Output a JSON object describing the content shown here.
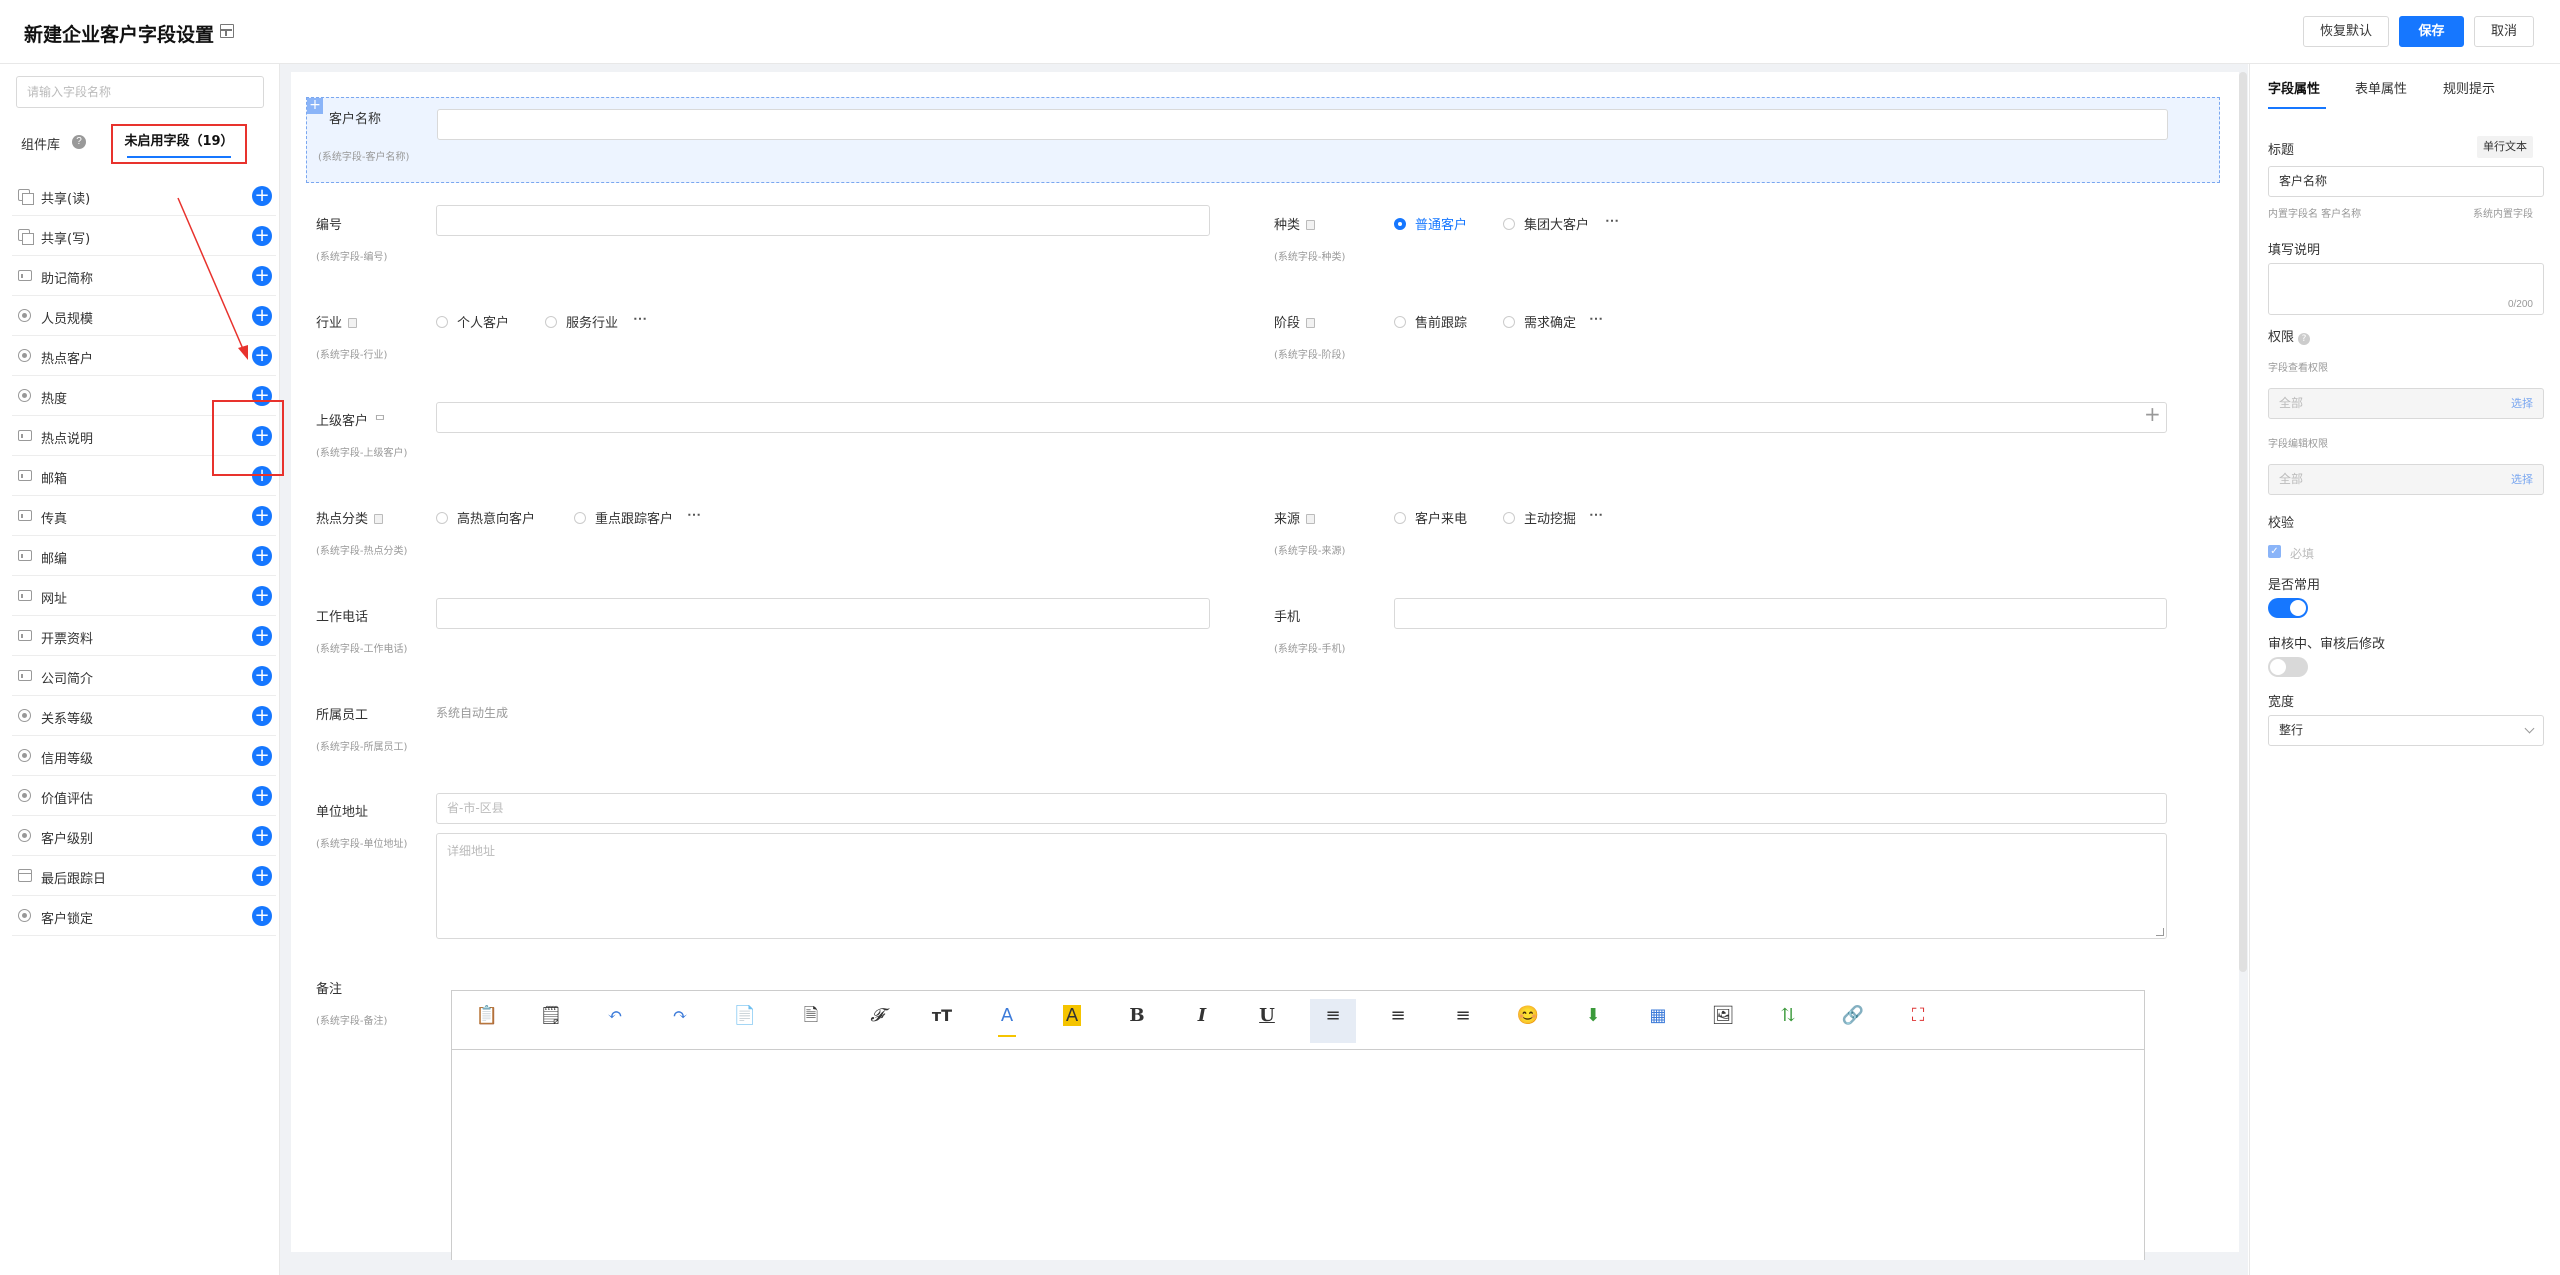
{
  "header": {
    "title": "新建企业客户字段设置",
    "btn_restore": "恢复默认",
    "btn_save": "保存",
    "btn_cancel": "取消"
  },
  "left": {
    "search_placeholder": "请输入字段名称",
    "tab_library": "组件库",
    "tab_unused": "未启用字段（19）",
    "fields": [
      {
        "label": "共享(读)",
        "icon": "share-icon"
      },
      {
        "label": "共享(写)",
        "icon": "share-icon"
      },
      {
        "label": "助记简称",
        "icon": "text-field-icon"
      },
      {
        "label": "人员规模",
        "icon": "radio-icon"
      },
      {
        "label": "热点客户",
        "icon": "radio-icon"
      },
      {
        "label": "热度",
        "icon": "radio-icon"
      },
      {
        "label": "热点说明",
        "icon": "text-field-icon"
      },
      {
        "label": "邮箱",
        "icon": "text-field-icon"
      },
      {
        "label": "传真",
        "icon": "text-field-icon"
      },
      {
        "label": "邮编",
        "icon": "text-field-icon"
      },
      {
        "label": "网址",
        "icon": "text-field-icon"
      },
      {
        "label": "开票资料",
        "icon": "text-field-icon"
      },
      {
        "label": "公司简介",
        "icon": "textarea-icon"
      },
      {
        "label": "关系等级",
        "icon": "radio-icon"
      },
      {
        "label": "信用等级",
        "icon": "radio-icon"
      },
      {
        "label": "价值评估",
        "icon": "radio-icon"
      },
      {
        "label": "客户级别",
        "icon": "radio-icon"
      },
      {
        "label": "最后跟踪日",
        "icon": "calendar-icon"
      },
      {
        "label": "客户锁定",
        "icon": "radio-icon"
      }
    ]
  },
  "form": {
    "customer_name": {
      "label": "客户名称",
      "sub": "(系统字段-客户名称)"
    },
    "code": {
      "label": "编号",
      "sub": "(系统字段-编号)"
    },
    "kind": {
      "label": "种类",
      "sub": "(系统字段-种类)",
      "options": [
        "普通客户",
        "集团大客户"
      ],
      "selected": "普通客户"
    },
    "industry": {
      "label": "行业",
      "sub": "(系统字段-行业)",
      "options": [
        "个人客户",
        "服务行业"
      ]
    },
    "stage": {
      "label": "阶段",
      "sub": "(系统字段-阶段)",
      "options": [
        "售前跟踪",
        "需求确定"
      ]
    },
    "parent": {
      "label": "上级客户",
      "sub": "(系统字段-上级客户)"
    },
    "hot_class": {
      "label": "热点分类",
      "sub": "(系统字段-热点分类)",
      "options": [
        "高热意向客户",
        "重点跟踪客户"
      ]
    },
    "source": {
      "label": "来源",
      "sub": "(系统字段-来源)",
      "options": [
        "客户来电",
        "主动挖掘"
      ]
    },
    "work_phone": {
      "label": "工作电话",
      "sub": "(系统字段-工作电话)"
    },
    "mobile": {
      "label": "手机",
      "sub": "(系统字段-手机)"
    },
    "staff": {
      "label": "所属员工",
      "sub": "(系统字段-所属员工)",
      "value": "系统自动生成"
    },
    "address": {
      "label": "单位地址",
      "sub": "(系统字段-单位地址)",
      "region_placeholder": "省-市-区县",
      "detail_placeholder": "详细地址"
    },
    "remark": {
      "label": "备注",
      "sub": "(系统字段-备注)"
    },
    "more": "⋯"
  },
  "right": {
    "tabs": [
      "字段属性",
      "表单属性",
      "规则提示"
    ],
    "title_label": "标题",
    "type_badge": "单行文本",
    "title_value": "客户名称",
    "internal_name": "内置字段名 客户名称",
    "system_builtin": "系统内置字段",
    "fill_desc": "填写说明",
    "counter": "0/200",
    "permission": "权限",
    "view_perm": "字段查看权限",
    "edit_perm": "字段编辑权限",
    "perm_value": "全部",
    "select_link": "选择",
    "validate": "校验",
    "required": "必填",
    "common_use": "是否常用",
    "common_use_on": true,
    "audit_modify": "审核中、审核后修改",
    "audit_modify_on": false,
    "width_label": "宽度",
    "width_value": "整行"
  }
}
